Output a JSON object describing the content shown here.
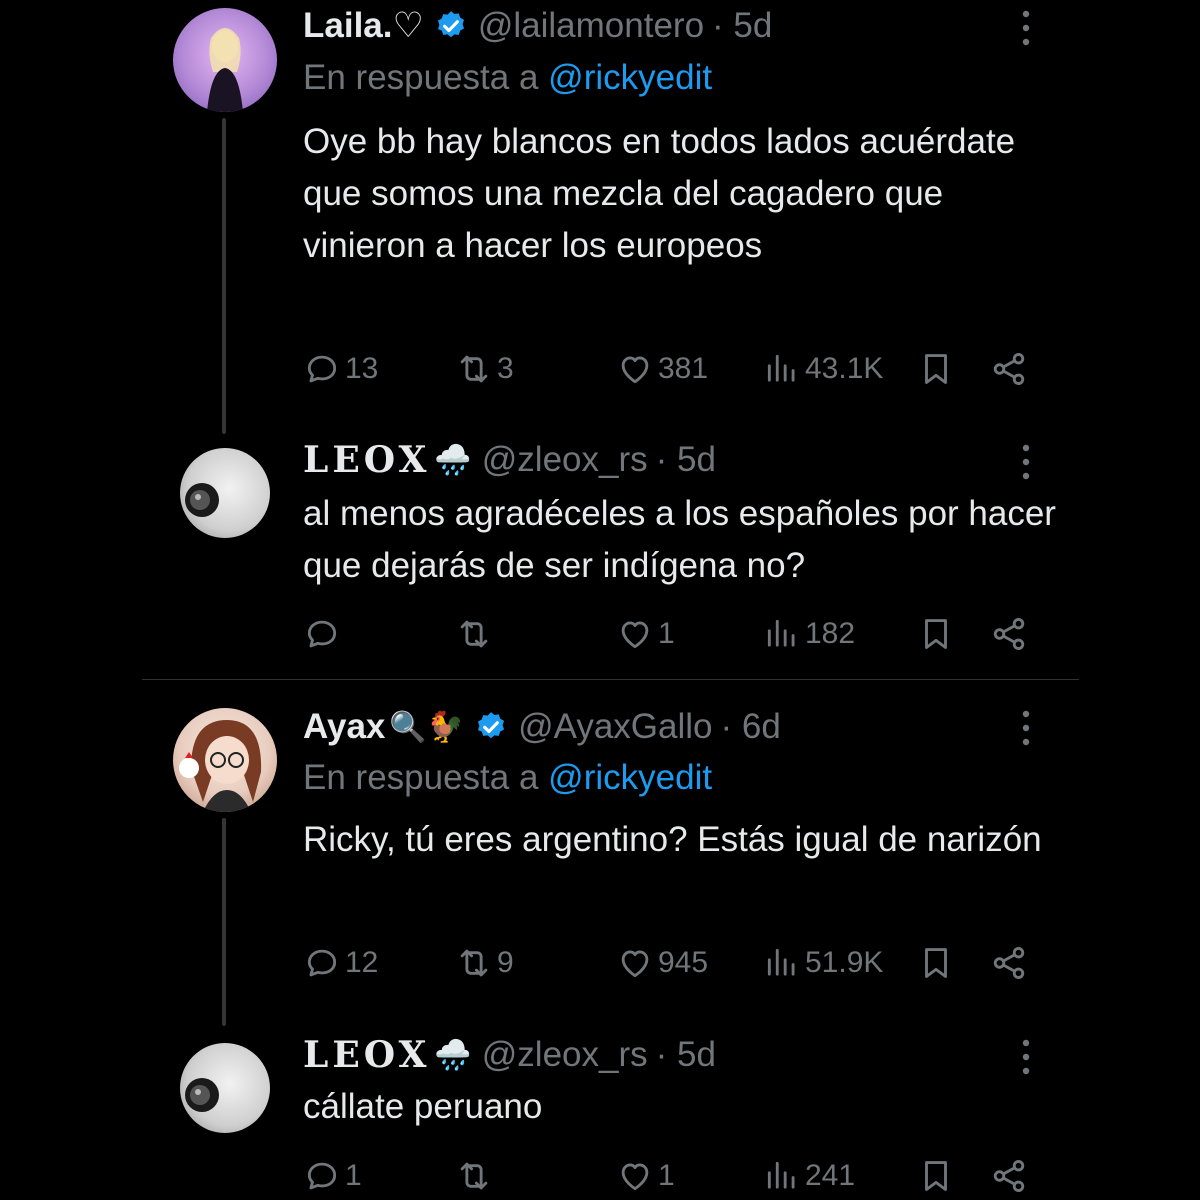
{
  "tweets": [
    {
      "name": "Laila.♡",
      "handle": "@lailamontero",
      "time": "· 5d",
      "reply_prefix": "En respuesta a",
      "reply_mention": "@rickyedit",
      "text": "Oye bb hay blancos en todos lados acuérdate que somos una mezcla del cagadero que vinieron a hacer los europeos",
      "replies": "13",
      "retweets": "3",
      "likes": "381",
      "views": "43.1K"
    },
    {
      "name": "LEOX",
      "name_emoji": "🌧️",
      "handle": "@zleox_rs",
      "time": "· 5d",
      "text": "al menos agradéceles a los españoles por hacer que dejarás de ser indígena no?",
      "replies": "",
      "retweets": "",
      "likes": "1",
      "views": "182"
    },
    {
      "name": "Ayax",
      "name_emoji": "🔍🐓",
      "handle": "@AyaxGallo",
      "time": "· 6d",
      "reply_prefix": "En respuesta a",
      "reply_mention": "@rickyedit",
      "text": "Ricky, tú eres argentino? Estás igual de narizón",
      "replies": "12",
      "retweets": "9",
      "likes": "945",
      "views": "51.9K"
    },
    {
      "name": "LEOX",
      "name_emoji": "🌧️",
      "handle": "@zleox_rs",
      "time": "· 5d",
      "text": "cállate peruano",
      "replies": "1",
      "retweets": "",
      "likes": "1",
      "views": "241"
    }
  ],
  "colors": {
    "background": "#000000",
    "text": "#e7e9ea",
    "muted": "#71767b",
    "accent": "#1d9bf0",
    "divider": "#2f3336"
  },
  "icons": [
    "verified-badge-icon",
    "more-options-icon",
    "reply-icon",
    "retweet-icon",
    "like-icon",
    "views-icon",
    "bookmark-icon",
    "share-icon"
  ]
}
